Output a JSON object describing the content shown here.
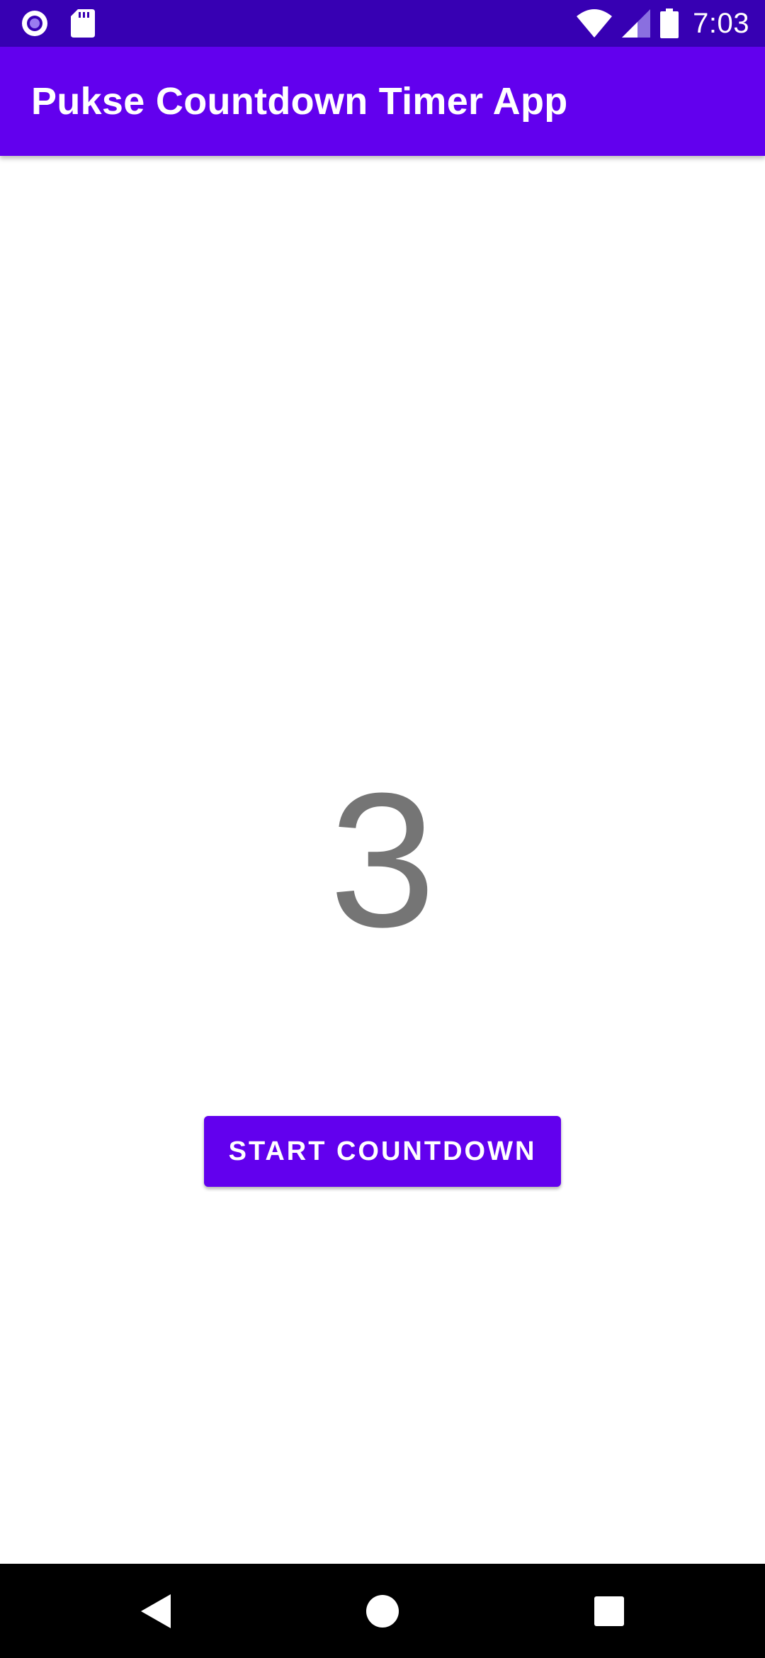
{
  "status_bar": {
    "time": "7:03",
    "left_icons": [
      "record-icon",
      "sd-card-icon"
    ],
    "right_icons": [
      "wifi-icon",
      "cell-signal-icon",
      "battery-icon"
    ],
    "background": "#3700B3"
  },
  "app_bar": {
    "title": "Pukse Countdown Timer App",
    "background": "#6200EE"
  },
  "main": {
    "countdown_value": "3",
    "start_button_label": "START COUNTDOWN",
    "accent_color": "#6200EE",
    "counter_color": "#757575"
  },
  "navigation_bar": {
    "buttons": [
      "back-icon",
      "home-icon",
      "recents-icon"
    ]
  }
}
